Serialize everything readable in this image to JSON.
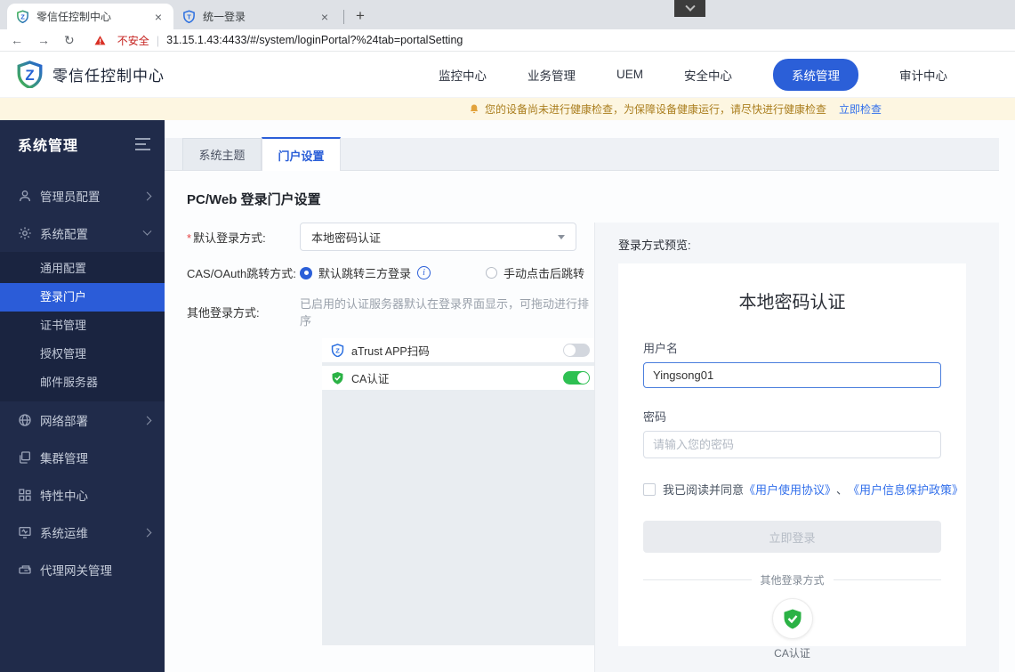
{
  "browser": {
    "tabs": [
      {
        "title": "零信任控制中心"
      },
      {
        "title": "统一登录"
      }
    ],
    "close_label": "×",
    "new_tab_label": "+",
    "security_label": "不安全",
    "url": "31.15.1.43:4433/#/system/loginPortal?%24tab=portalSetting"
  },
  "header": {
    "app_title": "零信任控制中心",
    "nav": [
      {
        "label": "监控中心"
      },
      {
        "label": "业务管理"
      },
      {
        "label": "UEM"
      },
      {
        "label": "安全中心"
      },
      {
        "label": "系统管理",
        "active": true
      },
      {
        "label": "审计中心"
      }
    ]
  },
  "banner": {
    "text": "您的设备尚未进行健康检查，为保障设备健康运行，请尽快进行健康检查",
    "link": "立即检查"
  },
  "sidebar": {
    "title": "系统管理",
    "items": [
      {
        "label": "管理员配置",
        "icon": "user",
        "chevron": "right"
      },
      {
        "label": "系统配置",
        "icon": "gear",
        "chevron": "down",
        "children": [
          {
            "label": "通用配置"
          },
          {
            "label": "登录门户",
            "active": true
          },
          {
            "label": "证书管理"
          },
          {
            "label": "授权管理"
          },
          {
            "label": "邮件服务器"
          }
        ]
      },
      {
        "label": "网络部署",
        "icon": "globe",
        "chevron": "right"
      },
      {
        "label": "集群管理",
        "icon": "cluster"
      },
      {
        "label": "特性中心",
        "icon": "grid"
      },
      {
        "label": "系统运维",
        "icon": "monitor",
        "chevron": "right"
      },
      {
        "label": "代理网关管理",
        "icon": "gateway"
      }
    ]
  },
  "main": {
    "tabs": [
      {
        "label": "系统主题"
      },
      {
        "label": "门户设置",
        "active": true
      }
    ],
    "heading": "PC/Web 登录门户设置",
    "form": {
      "default_login": {
        "label": "默认登录方式:",
        "value": "本地密码认证"
      },
      "cas": {
        "label": "CAS/OAuth跳转方式:",
        "option1": "默认跳转三方登录",
        "option2": "手动点击后跳转"
      },
      "other": {
        "label": "其他登录方式:",
        "hint": "已启用的认证服务器默认在登录界面显示，可拖动进行排序",
        "servers": [
          {
            "name": "aTrust APP扫码",
            "enabled": false
          },
          {
            "name": "CA认证",
            "enabled": true
          }
        ]
      }
    },
    "preview": {
      "label": "登录方式预览:",
      "title": "本地密码认证",
      "username": {
        "label": "用户名",
        "value": "Yingsong01"
      },
      "password": {
        "label": "密码",
        "placeholder": "请输入您的密码"
      },
      "agreement": {
        "prefix": "我已阅读并同意",
        "link1": "《用户使用协议》",
        "separator": "、",
        "link2": "《用户信息保护政策》"
      },
      "login_button": "立即登录",
      "divider": "其他登录方式",
      "other_method": "CA认证"
    }
  },
  "colors": {
    "primary": "#2b5fd8",
    "sidebar_bg": "#202b4a",
    "toggle_on": "#2ec052",
    "success_green": "#2bb245",
    "banner_bg": "#fdf6e1",
    "banner_text": "#aa7e1e",
    "danger": "#d93025",
    "link": "#3370eb"
  }
}
